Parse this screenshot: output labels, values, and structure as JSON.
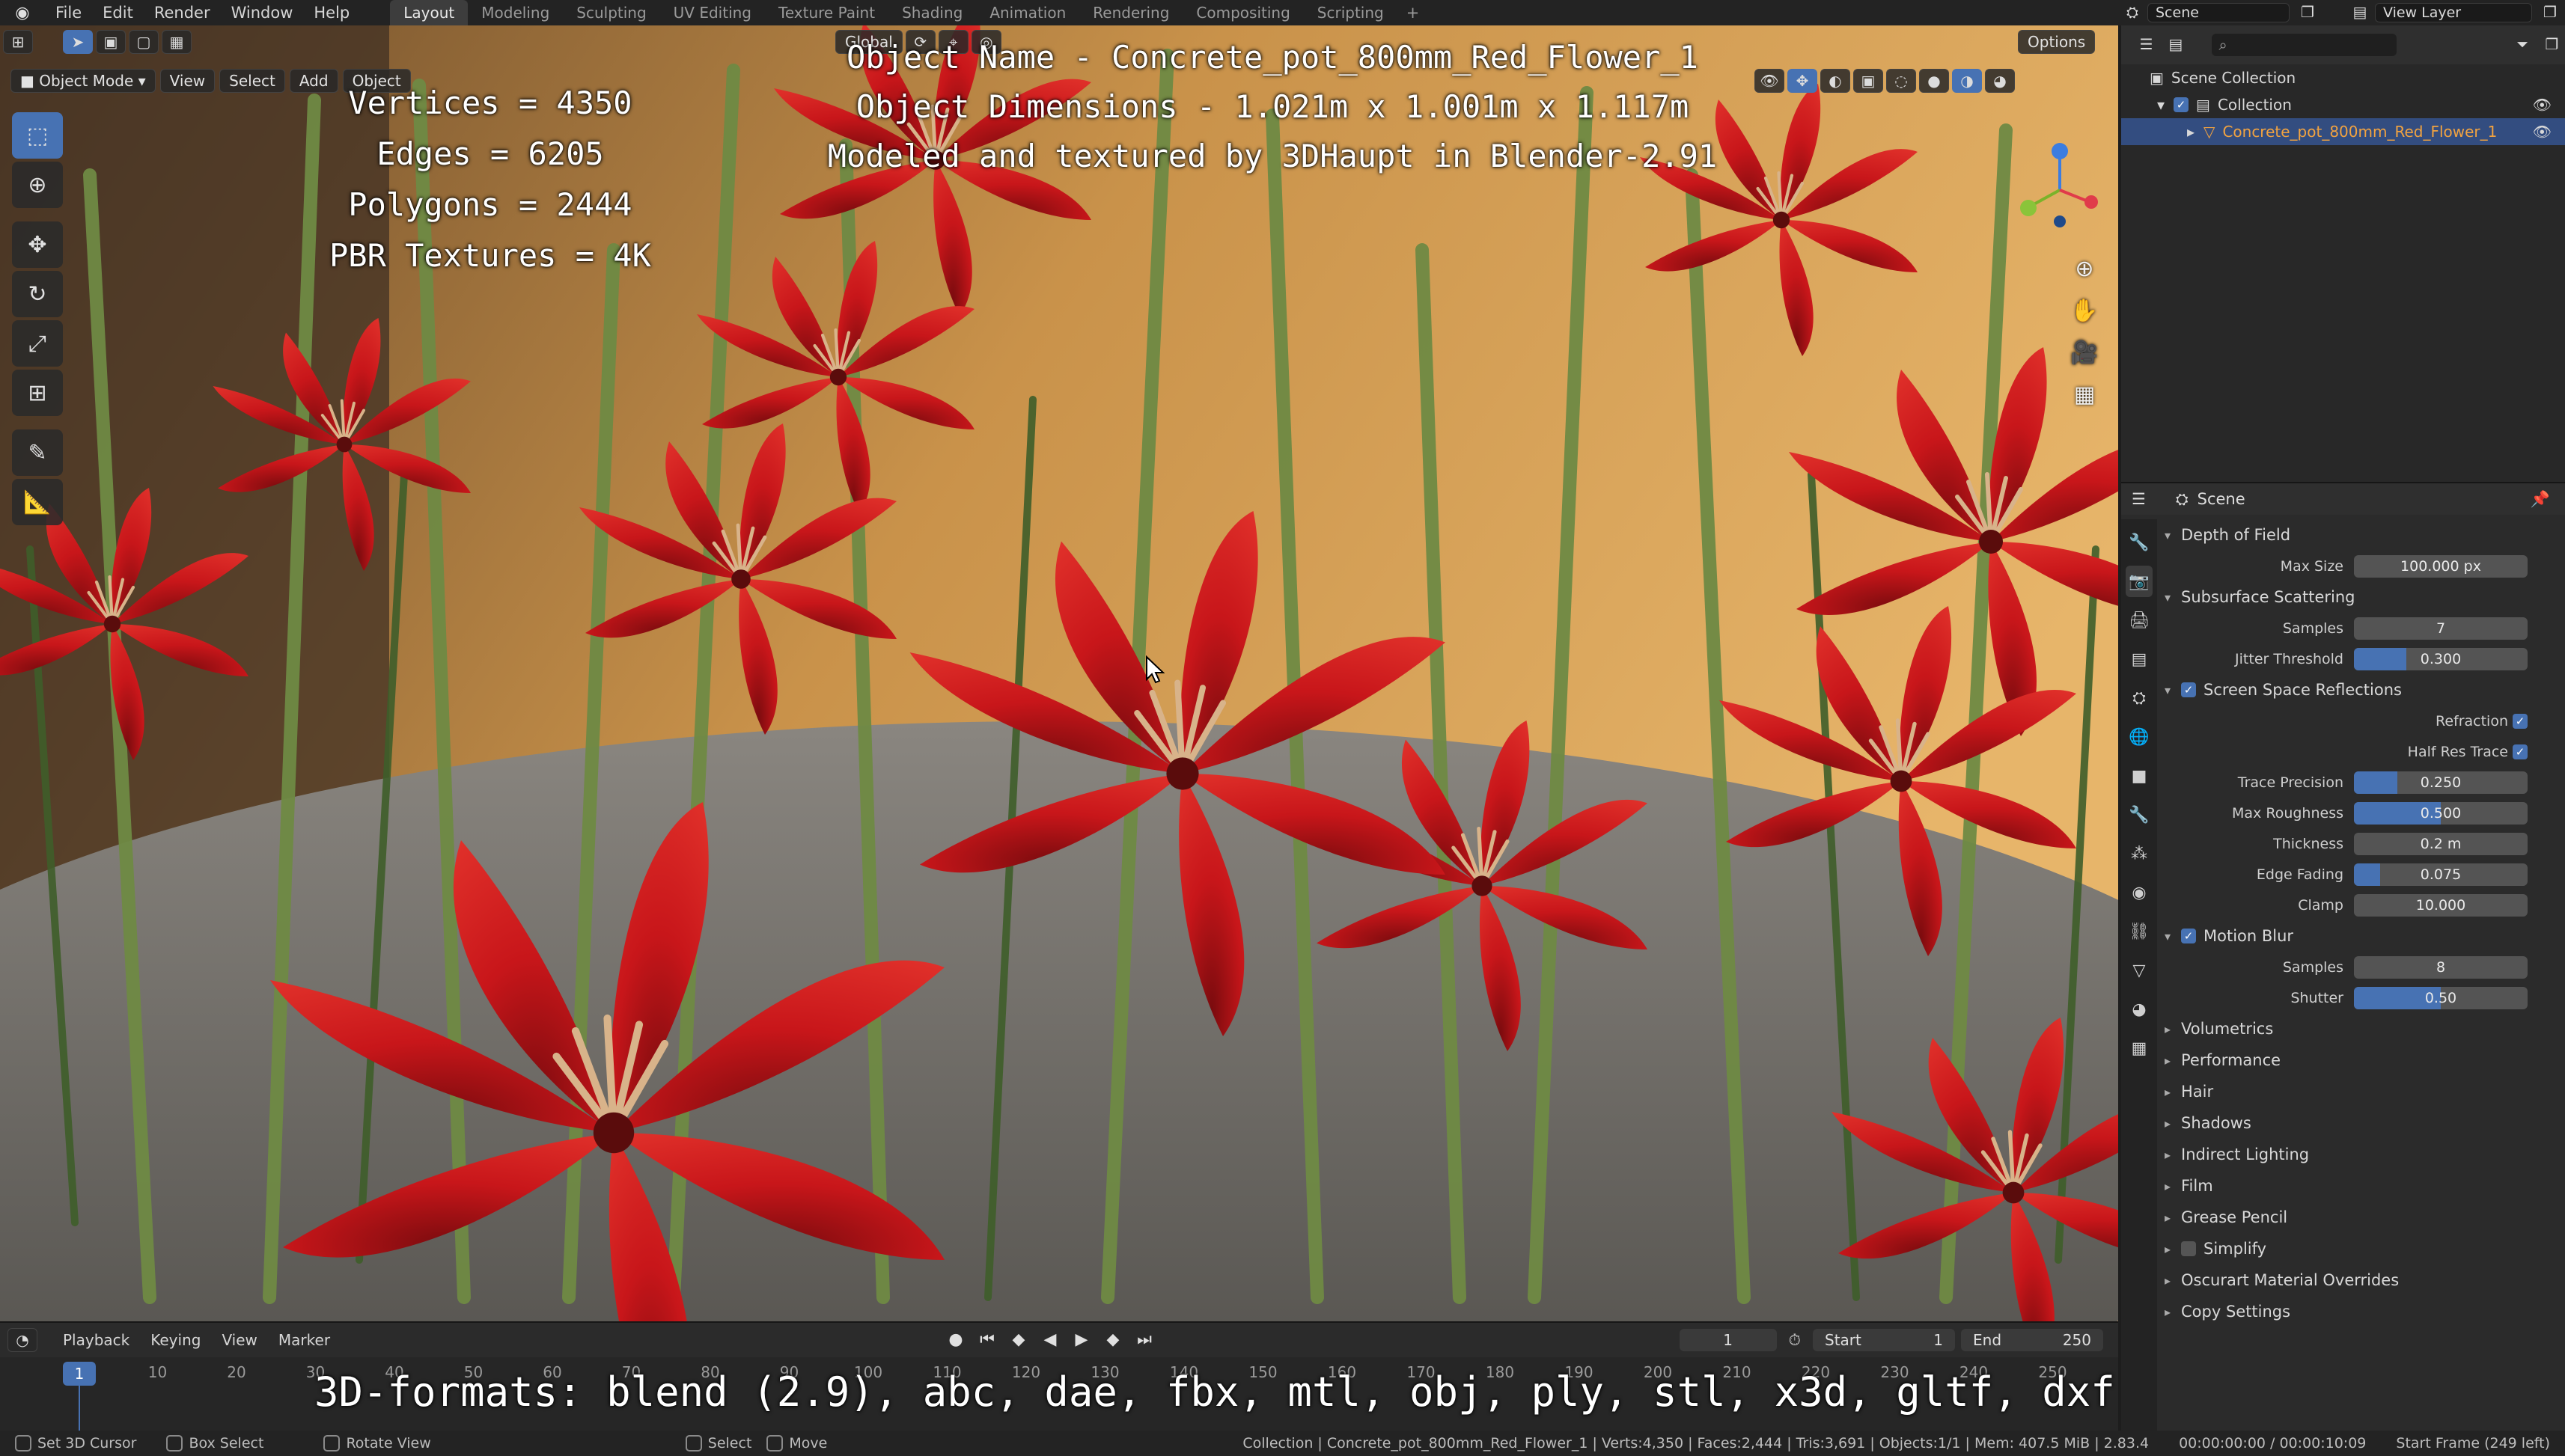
{
  "topbar": {
    "menus": [
      "File",
      "Edit",
      "Render",
      "Window",
      "Help"
    ],
    "workspaces": [
      "Layout",
      "Modeling",
      "Sculpting",
      "UV Editing",
      "Texture Paint",
      "Shading",
      "Animation",
      "Rendering",
      "Compositing",
      "Scripting"
    ],
    "active_workspace": "Layout",
    "add_tab": "+",
    "scene": "Scene",
    "view_layer": "View Layer"
  },
  "viewport": {
    "mode": "Object Mode",
    "menus": [
      "View",
      "Select",
      "Add",
      "Object"
    ],
    "transform_orientation": "Global",
    "options_label": "Options"
  },
  "overlay": {
    "title_lines": [
      "Object Name - Concrete_pot_800mm_Red_Flower_1",
      "Object Dimensions -  1.021m x 1.001m x 1.117m",
      "Modeled and textured by 3DHaupt in Blender-2.91"
    ],
    "stats_lines": [
      "Vertices = 4350",
      "Edges = 6205",
      "Polygons = 2444",
      "PBR Textures = 4K"
    ],
    "formats_line": "3D-formats: blend (2.9), abc, dae, fbx, mtl, obj, ply, stl, x3d, gltf, dxf"
  },
  "timeline": {
    "menus": [
      "Playback",
      "Keying",
      "View",
      "Marker"
    ],
    "current_frame": "1",
    "start_label": "Start",
    "start_value": "1",
    "end_label": "End",
    "end_value": "250",
    "ruler_ticks": [
      "1",
      "10",
      "20",
      "30",
      "40",
      "50",
      "60",
      "70",
      "80",
      "90",
      "100",
      "110",
      "120",
      "130",
      "140",
      "150",
      "160",
      "170",
      "180",
      "190",
      "200",
      "210",
      "220",
      "230",
      "240",
      "250"
    ]
  },
  "statusbar": {
    "left": [
      "Set 3D Cursor",
      "Box Select",
      "Rotate View",
      "Select",
      "Move"
    ],
    "info": "Collection | Concrete_pot_800mm_Red_Flower_1 | Verts:4,350 | Faces:2,444 | Tris:3,691 | Objects:1/1 | Mem: 407.5 MiB | 2.83.4",
    "time": "00:00:00:00 / 00:00:10:09",
    "start_frame": "Start Frame (249 left)"
  },
  "outliner": {
    "rows": [
      {
        "label": "Scene Collection"
      },
      {
        "label": "Collection"
      },
      {
        "label": "Concrete_pot_800mm_Red_Flower_1"
      }
    ]
  },
  "properties": {
    "context": "Scene",
    "panels": {
      "dof": {
        "title": "Depth of Field",
        "max_size_label": "Max Size",
        "max_size": "100.000 px"
      },
      "sss": {
        "title": "Subsurface Scattering",
        "samples_label": "Samples",
        "samples": "7",
        "jitter_label": "Jitter Threshold",
        "jitter": "0.300",
        "jitter_fraction": 0.3
      },
      "ssr": {
        "title": "Screen Space Reflections",
        "refraction_label": "Refraction",
        "half_res_label": "Half Res Trace",
        "trace_precision_label": "Trace Precision",
        "trace_precision": "0.250",
        "trace_precision_fraction": 0.25,
        "max_roughness_label": "Max Roughness",
        "max_roughness": "0.500",
        "max_roughness_fraction": 0.5,
        "thickness_label": "Thickness",
        "thickness": "0.2 m",
        "edge_fading_label": "Edge Fading",
        "edge_fading": "0.075",
        "edge_fading_fraction": 0.15,
        "clamp_label": "Clamp",
        "clamp": "10.000"
      },
      "motion_blur": {
        "title": "Motion Blur",
        "samples_label": "Samples",
        "samples": "8",
        "shutter_label": "Shutter",
        "shutter": "0.50",
        "shutter_fraction": 0.5
      },
      "collapsed": [
        "Volumetrics",
        "Performance",
        "Hair",
        "Shadows",
        "Indirect Lighting",
        "Film",
        "Grease Pencil",
        "Simplify",
        "Oscurart Material Overrides",
        "Copy Settings"
      ]
    }
  },
  "colors": {
    "accent": "#4772b3",
    "selection": "#334d80",
    "petal_red": "#c8161a",
    "stem_green": "#5f7a3a"
  }
}
